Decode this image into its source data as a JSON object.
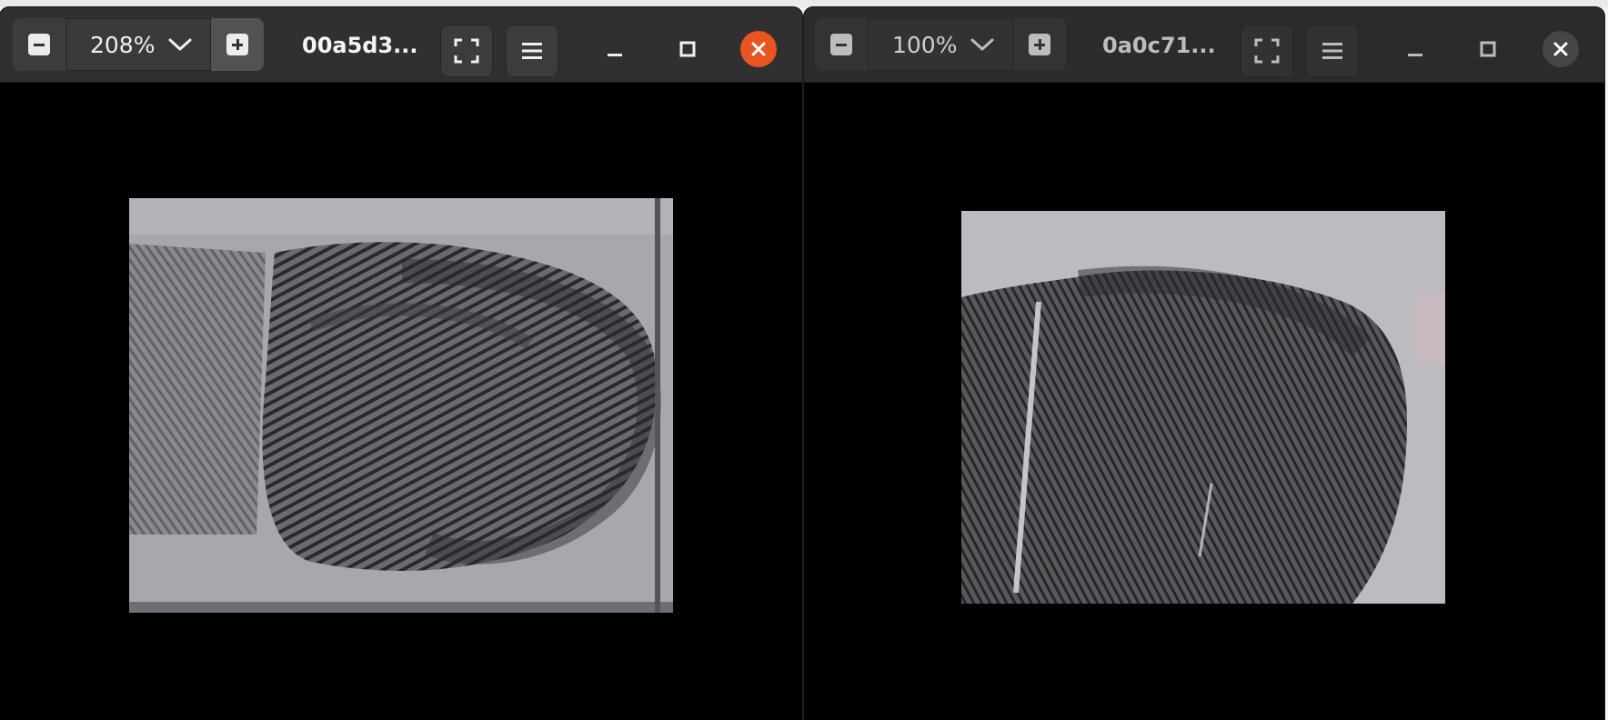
{
  "windows": [
    {
      "zoom_label": "208%",
      "title": "00a5d3...",
      "active": true
    },
    {
      "zoom_label": "100%",
      "title": "0a0c71...",
      "active": false
    }
  ],
  "colors": {
    "headerbar": "#303030",
    "close_active": "#e95420",
    "close_inactive": "#464646",
    "viewer_background": "#000000"
  },
  "icons": {
    "zoom_out": "minus-icon",
    "zoom_in": "plus-icon",
    "zoom_dropdown": "chevron-down-icon",
    "fullscreen": "fullscreen-icon",
    "menu": "hamburger-menu-icon",
    "minimize": "minimize-icon",
    "maximize": "maximize-icon",
    "close": "close-icon"
  }
}
